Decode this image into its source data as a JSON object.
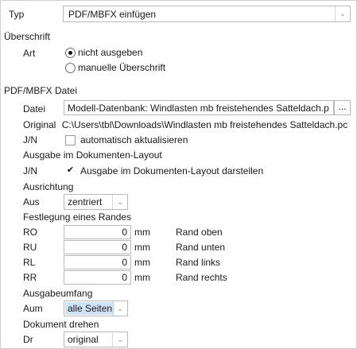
{
  "typ": {
    "label": "Typ",
    "value": "PDF/MBFX einfügen"
  },
  "ueberschrift": {
    "section": "Überschrift",
    "art_label": "Art",
    "options": [
      "nicht ausgeben",
      "manuelle Überschrift"
    ],
    "selected": "nicht ausgeben"
  },
  "datei_section": {
    "section": "PDF/MBFX Datei",
    "datei_label": "Datei",
    "datei_value": "Modell-Datenbank: Windlasten mb freistehendes Satteldach.p",
    "browse_label": "...",
    "original_label": "Original",
    "original_value": "C:\\Users\\tbl\\Downloads\\Windlasten mb freistehendes Satteldach.pc",
    "jn_label": "J/N",
    "auto_update_label": "automatisch aktualisieren",
    "auto_update_checked": false
  },
  "layout": {
    "section": "Ausgabe im Dokumenten-Layout",
    "jn_label": "J/N",
    "checkbox_label": "Ausgabe im Dokumenten-Layout darstellen",
    "checked": true
  },
  "ausrichtung": {
    "section": "Ausrichtung",
    "label": "Aus",
    "value": "zentriert"
  },
  "rand": {
    "section": "Festlegung eines Randes",
    "unit": "mm",
    "rows": [
      {
        "code": "RO",
        "value": "0",
        "desc": "Rand oben"
      },
      {
        "code": "RU",
        "value": "0",
        "desc": "Rand unten"
      },
      {
        "code": "RL",
        "value": "0",
        "desc": "Rand links"
      },
      {
        "code": "RR",
        "value": "0",
        "desc": "Rand rechts"
      }
    ]
  },
  "ausgabeumfang": {
    "section": "Ausgabeumfang",
    "label": "Aum",
    "value": "alle Seiten"
  },
  "drehen": {
    "section": "Dokument drehen",
    "label": "Dr",
    "value": "original"
  },
  "icons": {
    "dropdown": "chevron-down-icon",
    "check": "checkmark-icon"
  },
  "colors": {
    "selection": "#cfe3f7",
    "border": "#b9b9b9"
  }
}
